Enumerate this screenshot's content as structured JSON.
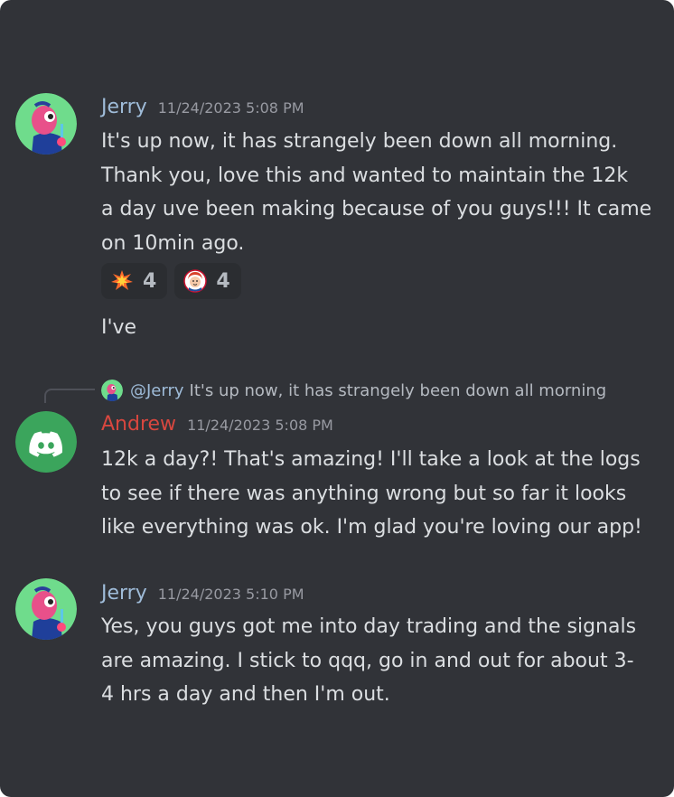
{
  "messages": [
    {
      "author": "Jerry",
      "timestamp": "11/24/2023 5:08 PM",
      "lines": [
        "It's up now, it has strangely been down all morning.",
        "Thank you,  love this and wanted to maintain the 12k",
        "a day uve been making because of you guys!!! It came",
        "on 10min ago."
      ],
      "reactions": [
        {
          "icon": "explosion-icon",
          "count": "4"
        },
        {
          "icon": "wendys-icon",
          "count": "4"
        }
      ],
      "followup": "I've"
    },
    {
      "author": "Andrew",
      "timestamp": "11/24/2023 5:08 PM",
      "reply": {
        "mention": "@Jerry",
        "preview": "It's up now, it has strangely been down all morning"
      },
      "lines": [
        "12k a day?! That's amazing! I'll take a look at the logs",
        "to see if there was anything wrong but so far it looks",
        "like everything was ok. I'm glad you're loving our app!"
      ]
    },
    {
      "author": "Jerry",
      "timestamp": "11/24/2023 5:10 PM",
      "lines": [
        "Yes, you guys got me into day trading and the signals",
        "are amazing. I stick to qqq, go in and out for about 3-",
        "4 hrs a day and then I'm out."
      ]
    }
  ],
  "colors": {
    "background": "#313338",
    "jerry_name": "#9fbcd9",
    "andrew_name": "#d8473f",
    "text": "#dbdee1",
    "timestamp": "#989aa2",
    "discord_green": "#3ba55c"
  }
}
